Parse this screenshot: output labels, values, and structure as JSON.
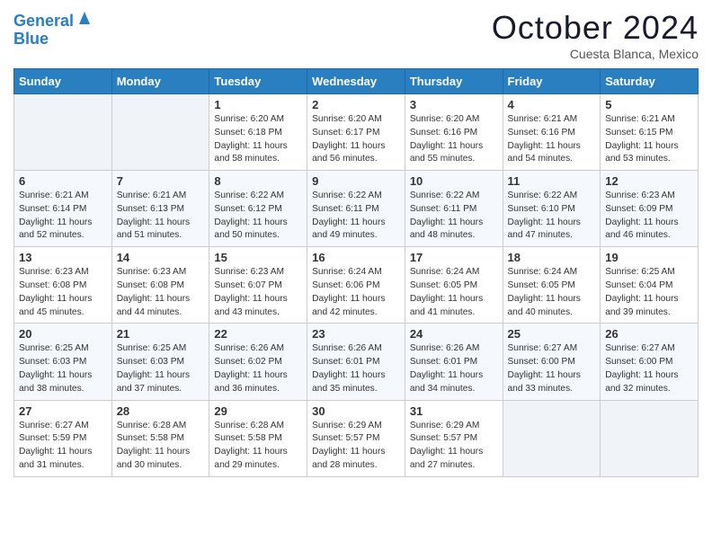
{
  "logo": {
    "line1": "General",
    "line2": "Blue"
  },
  "title": "October 2024",
  "location": "Cuesta Blanca, Mexico",
  "days_header": [
    "Sunday",
    "Monday",
    "Tuesday",
    "Wednesday",
    "Thursday",
    "Friday",
    "Saturday"
  ],
  "weeks": [
    [
      {
        "day": "",
        "sunrise": "",
        "sunset": "",
        "daylight": ""
      },
      {
        "day": "",
        "sunrise": "",
        "sunset": "",
        "daylight": ""
      },
      {
        "day": "1",
        "sunrise": "Sunrise: 6:20 AM",
        "sunset": "Sunset: 6:18 PM",
        "daylight": "Daylight: 11 hours and 58 minutes."
      },
      {
        "day": "2",
        "sunrise": "Sunrise: 6:20 AM",
        "sunset": "Sunset: 6:17 PM",
        "daylight": "Daylight: 11 hours and 56 minutes."
      },
      {
        "day": "3",
        "sunrise": "Sunrise: 6:20 AM",
        "sunset": "Sunset: 6:16 PM",
        "daylight": "Daylight: 11 hours and 55 minutes."
      },
      {
        "day": "4",
        "sunrise": "Sunrise: 6:21 AM",
        "sunset": "Sunset: 6:16 PM",
        "daylight": "Daylight: 11 hours and 54 minutes."
      },
      {
        "day": "5",
        "sunrise": "Sunrise: 6:21 AM",
        "sunset": "Sunset: 6:15 PM",
        "daylight": "Daylight: 11 hours and 53 minutes."
      }
    ],
    [
      {
        "day": "6",
        "sunrise": "Sunrise: 6:21 AM",
        "sunset": "Sunset: 6:14 PM",
        "daylight": "Daylight: 11 hours and 52 minutes."
      },
      {
        "day": "7",
        "sunrise": "Sunrise: 6:21 AM",
        "sunset": "Sunset: 6:13 PM",
        "daylight": "Daylight: 11 hours and 51 minutes."
      },
      {
        "day": "8",
        "sunrise": "Sunrise: 6:22 AM",
        "sunset": "Sunset: 6:12 PM",
        "daylight": "Daylight: 11 hours and 50 minutes."
      },
      {
        "day": "9",
        "sunrise": "Sunrise: 6:22 AM",
        "sunset": "Sunset: 6:11 PM",
        "daylight": "Daylight: 11 hours and 49 minutes."
      },
      {
        "day": "10",
        "sunrise": "Sunrise: 6:22 AM",
        "sunset": "Sunset: 6:11 PM",
        "daylight": "Daylight: 11 hours and 48 minutes."
      },
      {
        "day": "11",
        "sunrise": "Sunrise: 6:22 AM",
        "sunset": "Sunset: 6:10 PM",
        "daylight": "Daylight: 11 hours and 47 minutes."
      },
      {
        "day": "12",
        "sunrise": "Sunrise: 6:23 AM",
        "sunset": "Sunset: 6:09 PM",
        "daylight": "Daylight: 11 hours and 46 minutes."
      }
    ],
    [
      {
        "day": "13",
        "sunrise": "Sunrise: 6:23 AM",
        "sunset": "Sunset: 6:08 PM",
        "daylight": "Daylight: 11 hours and 45 minutes."
      },
      {
        "day": "14",
        "sunrise": "Sunrise: 6:23 AM",
        "sunset": "Sunset: 6:08 PM",
        "daylight": "Daylight: 11 hours and 44 minutes."
      },
      {
        "day": "15",
        "sunrise": "Sunrise: 6:23 AM",
        "sunset": "Sunset: 6:07 PM",
        "daylight": "Daylight: 11 hours and 43 minutes."
      },
      {
        "day": "16",
        "sunrise": "Sunrise: 6:24 AM",
        "sunset": "Sunset: 6:06 PM",
        "daylight": "Daylight: 11 hours and 42 minutes."
      },
      {
        "day": "17",
        "sunrise": "Sunrise: 6:24 AM",
        "sunset": "Sunset: 6:05 PM",
        "daylight": "Daylight: 11 hours and 41 minutes."
      },
      {
        "day": "18",
        "sunrise": "Sunrise: 6:24 AM",
        "sunset": "Sunset: 6:05 PM",
        "daylight": "Daylight: 11 hours and 40 minutes."
      },
      {
        "day": "19",
        "sunrise": "Sunrise: 6:25 AM",
        "sunset": "Sunset: 6:04 PM",
        "daylight": "Daylight: 11 hours and 39 minutes."
      }
    ],
    [
      {
        "day": "20",
        "sunrise": "Sunrise: 6:25 AM",
        "sunset": "Sunset: 6:03 PM",
        "daylight": "Daylight: 11 hours and 38 minutes."
      },
      {
        "day": "21",
        "sunrise": "Sunrise: 6:25 AM",
        "sunset": "Sunset: 6:03 PM",
        "daylight": "Daylight: 11 hours and 37 minutes."
      },
      {
        "day": "22",
        "sunrise": "Sunrise: 6:26 AM",
        "sunset": "Sunset: 6:02 PM",
        "daylight": "Daylight: 11 hours and 36 minutes."
      },
      {
        "day": "23",
        "sunrise": "Sunrise: 6:26 AM",
        "sunset": "Sunset: 6:01 PM",
        "daylight": "Daylight: 11 hours and 35 minutes."
      },
      {
        "day": "24",
        "sunrise": "Sunrise: 6:26 AM",
        "sunset": "Sunset: 6:01 PM",
        "daylight": "Daylight: 11 hours and 34 minutes."
      },
      {
        "day": "25",
        "sunrise": "Sunrise: 6:27 AM",
        "sunset": "Sunset: 6:00 PM",
        "daylight": "Daylight: 11 hours and 33 minutes."
      },
      {
        "day": "26",
        "sunrise": "Sunrise: 6:27 AM",
        "sunset": "Sunset: 6:00 PM",
        "daylight": "Daylight: 11 hours and 32 minutes."
      }
    ],
    [
      {
        "day": "27",
        "sunrise": "Sunrise: 6:27 AM",
        "sunset": "Sunset: 5:59 PM",
        "daylight": "Daylight: 11 hours and 31 minutes."
      },
      {
        "day": "28",
        "sunrise": "Sunrise: 6:28 AM",
        "sunset": "Sunset: 5:58 PM",
        "daylight": "Daylight: 11 hours and 30 minutes."
      },
      {
        "day": "29",
        "sunrise": "Sunrise: 6:28 AM",
        "sunset": "Sunset: 5:58 PM",
        "daylight": "Daylight: 11 hours and 29 minutes."
      },
      {
        "day": "30",
        "sunrise": "Sunrise: 6:29 AM",
        "sunset": "Sunset: 5:57 PM",
        "daylight": "Daylight: 11 hours and 28 minutes."
      },
      {
        "day": "31",
        "sunrise": "Sunrise: 6:29 AM",
        "sunset": "Sunset: 5:57 PM",
        "daylight": "Daylight: 11 hours and 27 minutes."
      },
      {
        "day": "",
        "sunrise": "",
        "sunset": "",
        "daylight": ""
      },
      {
        "day": "",
        "sunrise": "",
        "sunset": "",
        "daylight": ""
      }
    ]
  ]
}
